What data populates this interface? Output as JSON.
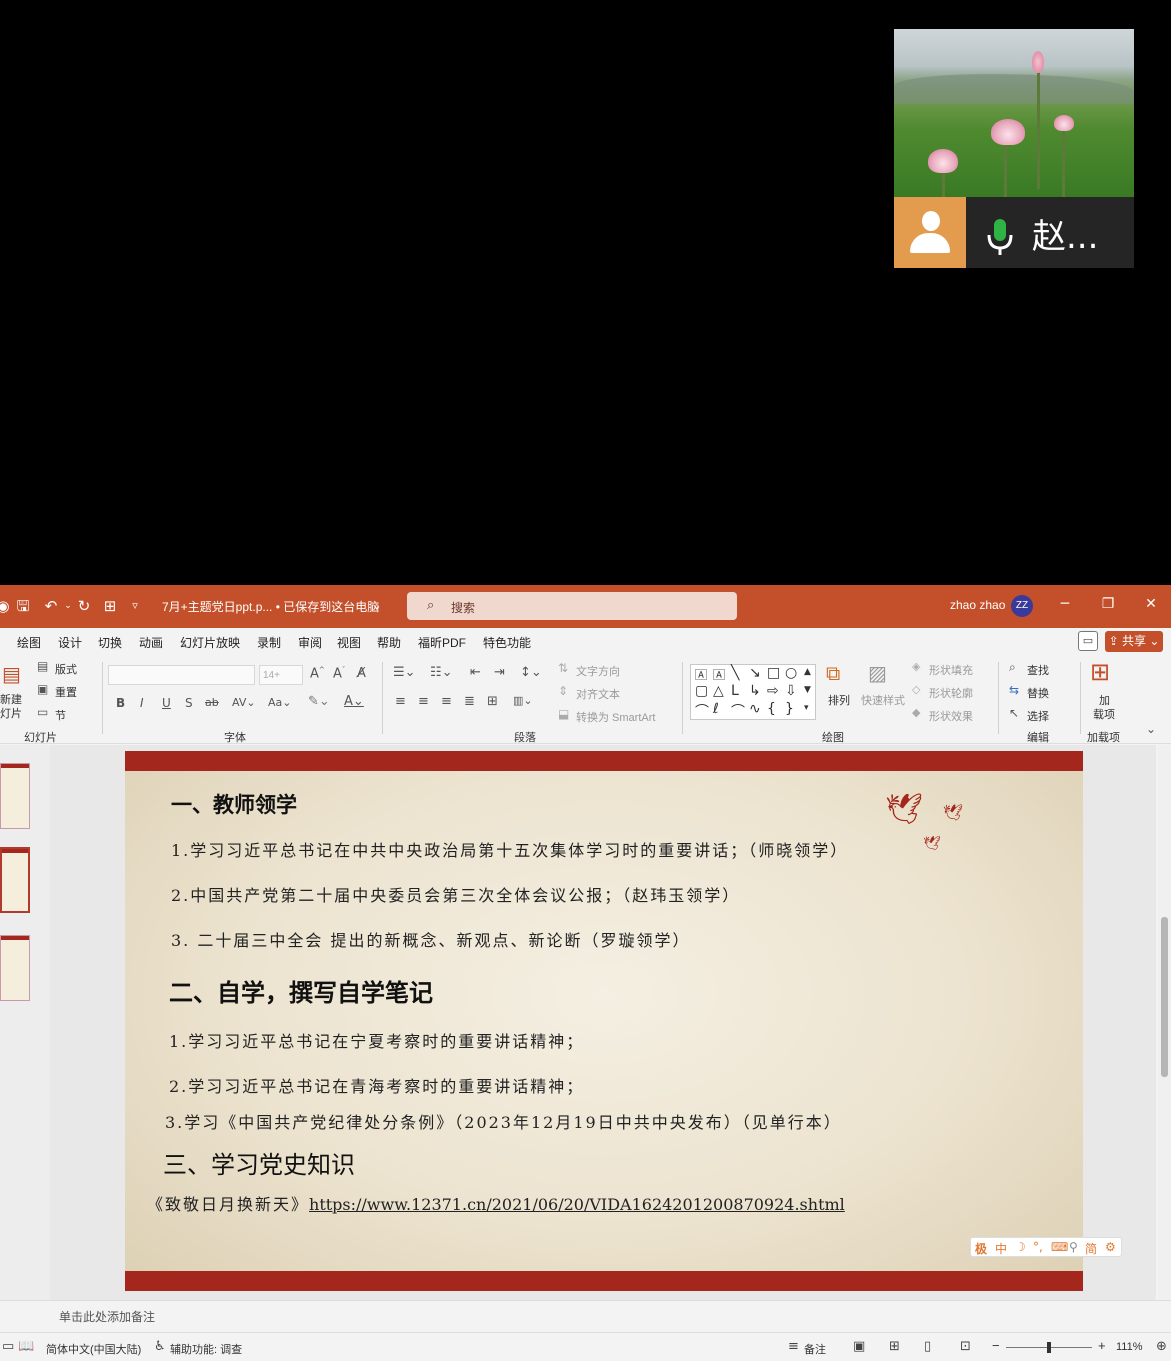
{
  "video": {
    "participant_name": "赵...",
    "avatar_color": "#e39b4d",
    "mic_color": "#2fb344",
    "icons": [
      "avatar-icon",
      "microphone-icon"
    ]
  },
  "titlebar": {
    "doc_title": "7月+主题党日ppt.p... • 已保存到这台电脑",
    "search_placeholder": "搜索",
    "user_name": "zhao zhao",
    "user_initials": "ZZ",
    "accent_color": "#c3502b"
  },
  "menu": {
    "items": [
      "绘图",
      "设计",
      "切换",
      "动画",
      "幻灯片放映",
      "录制",
      "审阅",
      "视图",
      "帮助",
      "福昕PDF",
      "特色功能"
    ],
    "share_label": "共享"
  },
  "ribbon": {
    "slides_group": {
      "new_slide": "新建",
      "new_slide2": "灯片",
      "layout": "版式",
      "reset": "重置",
      "section": "节",
      "label": "幻灯片"
    },
    "font_group": {
      "size": "14+",
      "label": "字体"
    },
    "paragraph_group": {
      "text_direction": "文字方向",
      "align_text": "对齐文本",
      "smartart": "转换为 SmartArt",
      "label": "段落"
    },
    "drawing_group": {
      "arrange": "排列",
      "quick_styles": "快速样式",
      "shape_fill": "形状填充",
      "shape_outline": "形状轮廓",
      "shape_effects": "形状效果",
      "label": "绘图"
    },
    "editing_group": {
      "find": "查找",
      "replace": "替换",
      "select": "选择",
      "label": "编辑"
    },
    "addins_group": {
      "addins1": "加",
      "addins2": "载项",
      "label": "加载项"
    }
  },
  "slide": {
    "heading1": "一、教师领学",
    "item1_1": "1.学习习近平总书记在中共中央政治局第十五次集体学习时的重要讲话；（师晓领学）",
    "item1_2": "2.中国共产党第二十届中央委员会第三次全体会议公报；（赵玮玉领学）",
    "item1_3": "3. 二十届三中全会 提出的新概念、新观点、新论断（罗璇领学）",
    "heading2": "二、自学，撰写自学笔记",
    "item2_1": "1.学习习近平总书记在宁夏考察时的重要讲话精神；",
    "item2_2": "2.学习习近平总书记在青海考察时的重要讲话精神；",
    "item2_3": "3.学习《中国共产党纪律处分条例》（2023年12月19日中共中央发布）（见单行本）",
    "heading3": "三、学习党史知识",
    "item3_title": "《致敬日月换新天》",
    "item3_link": "https://www.12371.cn/2021/06/20/VIDA1624201200870924.shtml",
    "border_color": "#a3271c"
  },
  "ime_bar": [
    "中",
    "简"
  ],
  "notes": {
    "placeholder": "单击此处添加备注"
  },
  "status": {
    "language": "简体中文(中国大陆)",
    "accessibility": "辅助功能: 调查",
    "notes_btn": "备注",
    "zoom": "111%"
  }
}
